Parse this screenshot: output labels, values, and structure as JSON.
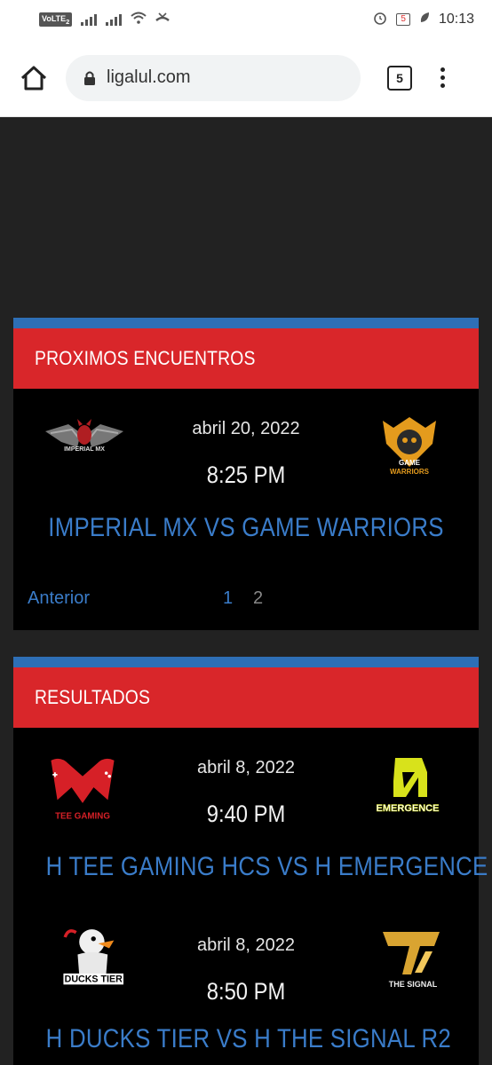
{
  "status_bar": {
    "volte": "VoLTE",
    "sim": "2",
    "battery": "5",
    "time": "10:13"
  },
  "browser": {
    "url": "ligalul.com",
    "tab_count": "5"
  },
  "upcoming": {
    "header": "PROXIMOS ENCUENTROS",
    "match": {
      "date": "abril 20, 2022",
      "time": "8:25 PM",
      "title": "IMPERIAL MX VS GAME WARRIORS",
      "home_logo_text": "IMPERIAL MX",
      "away_logo_text": [
        "GAME",
        "WARRIORS"
      ]
    },
    "pager": {
      "prev": "Anterior",
      "page1": "1",
      "page2": "2"
    }
  },
  "results": {
    "header": "RESULTADOS",
    "matches": [
      {
        "date": "abril 8, 2022",
        "time": "9:40 PM",
        "title": "H TEE GAMING HCS VS H EMERGENCE",
        "home_logo_text": "TEE GAMING",
        "away_logo_text": "EMERGENCE"
      },
      {
        "date": "abril 8, 2022",
        "time": "8:50 PM",
        "title": "H DUCKS TIER VS H THE SIGNAL R2",
        "home_logo_text": "DUCKS TIER",
        "away_logo_text": "THE SIGNAL"
      }
    ]
  },
  "colors": {
    "accent_red": "#d9262a",
    "accent_blue": "#2e6fb6",
    "link_blue": "#3a7cc9"
  }
}
